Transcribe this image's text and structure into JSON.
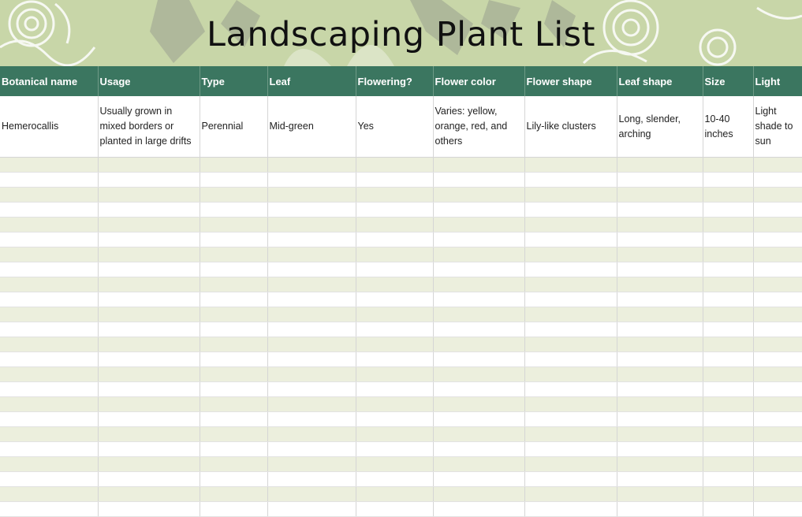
{
  "header": {
    "title": "Landscaping Plant List"
  },
  "colors": {
    "banner": "#c8d6a8",
    "header_row": "#3b7660",
    "band": "#ecefdd"
  },
  "columns": [
    "Botanical name",
    "Usage",
    "Type",
    "Leaf",
    "Flowering?",
    "Flower color",
    "Flower shape",
    "Leaf shape",
    "Size",
    "Light"
  ],
  "rows": [
    [
      "Hemerocallis",
      "Usually grown in mixed borders or planted in large drifts",
      "Perennial",
      "Mid-green",
      "Yes",
      "Varies: yellow, orange, red, and others",
      "Lily-like clusters",
      "Long, slender, arching",
      "10-40 inches",
      "Light shade to sun"
    ]
  ]
}
